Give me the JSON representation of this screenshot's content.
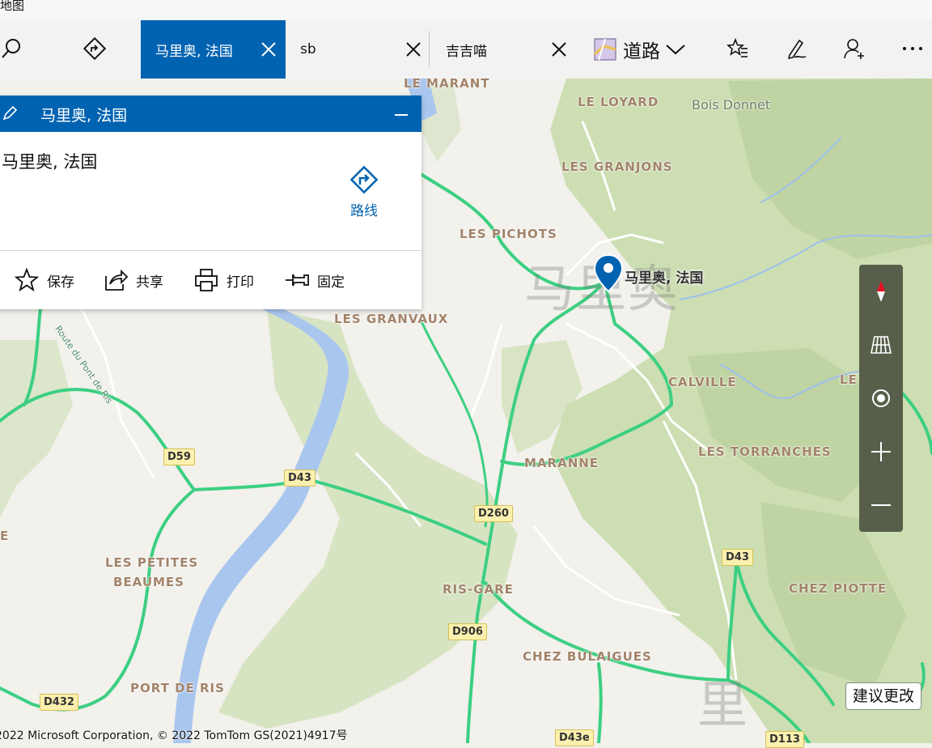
{
  "window": {
    "title": "地图"
  },
  "toolbar": {
    "tabs": [
      {
        "label": "马里奥, 法国"
      },
      {
        "label": "sb"
      },
      {
        "label": "吉吉喵"
      }
    ],
    "map_style": "道路"
  },
  "panel": {
    "header_title": "马里奥, 法国",
    "place_name": "马里奥, 法国",
    "route_label": "路线",
    "actions": {
      "save": "保存",
      "share": "共享",
      "print": "打印",
      "pin": "固定"
    }
  },
  "map": {
    "pin_label": "马里奥, 法国",
    "watermark_1": "马里奥",
    "watermark_2": "里",
    "places": {
      "le_marant": "LE MARANT",
      "le_loyard": "LE LOYARD",
      "bois_donnet": "Bois Donnet",
      "les_granjons": "LES GRANJONS",
      "les_pichots": "LES PICHOTS",
      "les_granvaux": "LES GRANVAUX",
      "calville": "CALVILLE",
      "le_right": "LE",
      "maranne": "MARANNE",
      "les_torranches": "LES TORRANCHES",
      "les_petites": "LES PETITES",
      "beaumes": "BEAUMES",
      "e_left": "E",
      "ris_gare": "RIS-GARE",
      "chez_piotte": "CHEZ PIOTTE",
      "chez_bulaigues": "CHEZ BULAIGUES",
      "port_de_ris": "PORT DE RIS"
    },
    "road_labels": {
      "d59": "D59",
      "d43_a": "D43",
      "d260": "D260",
      "d43_b": "D43",
      "d906": "D906",
      "d432": "D432",
      "d43e": "D43e",
      "d113": "D113"
    },
    "street_label": "Route du Pont de Ris",
    "suggest_button": "建议更改",
    "copyright": "2022 Microsoft Corporation, © 2022 TomTom GS(2021)4917号"
  },
  "colors": {
    "accent": "#0063b1",
    "road": "#3ccf82",
    "river": "#a9c6ee",
    "forest": "#c6dba8",
    "control_bg": "#575f4a"
  }
}
